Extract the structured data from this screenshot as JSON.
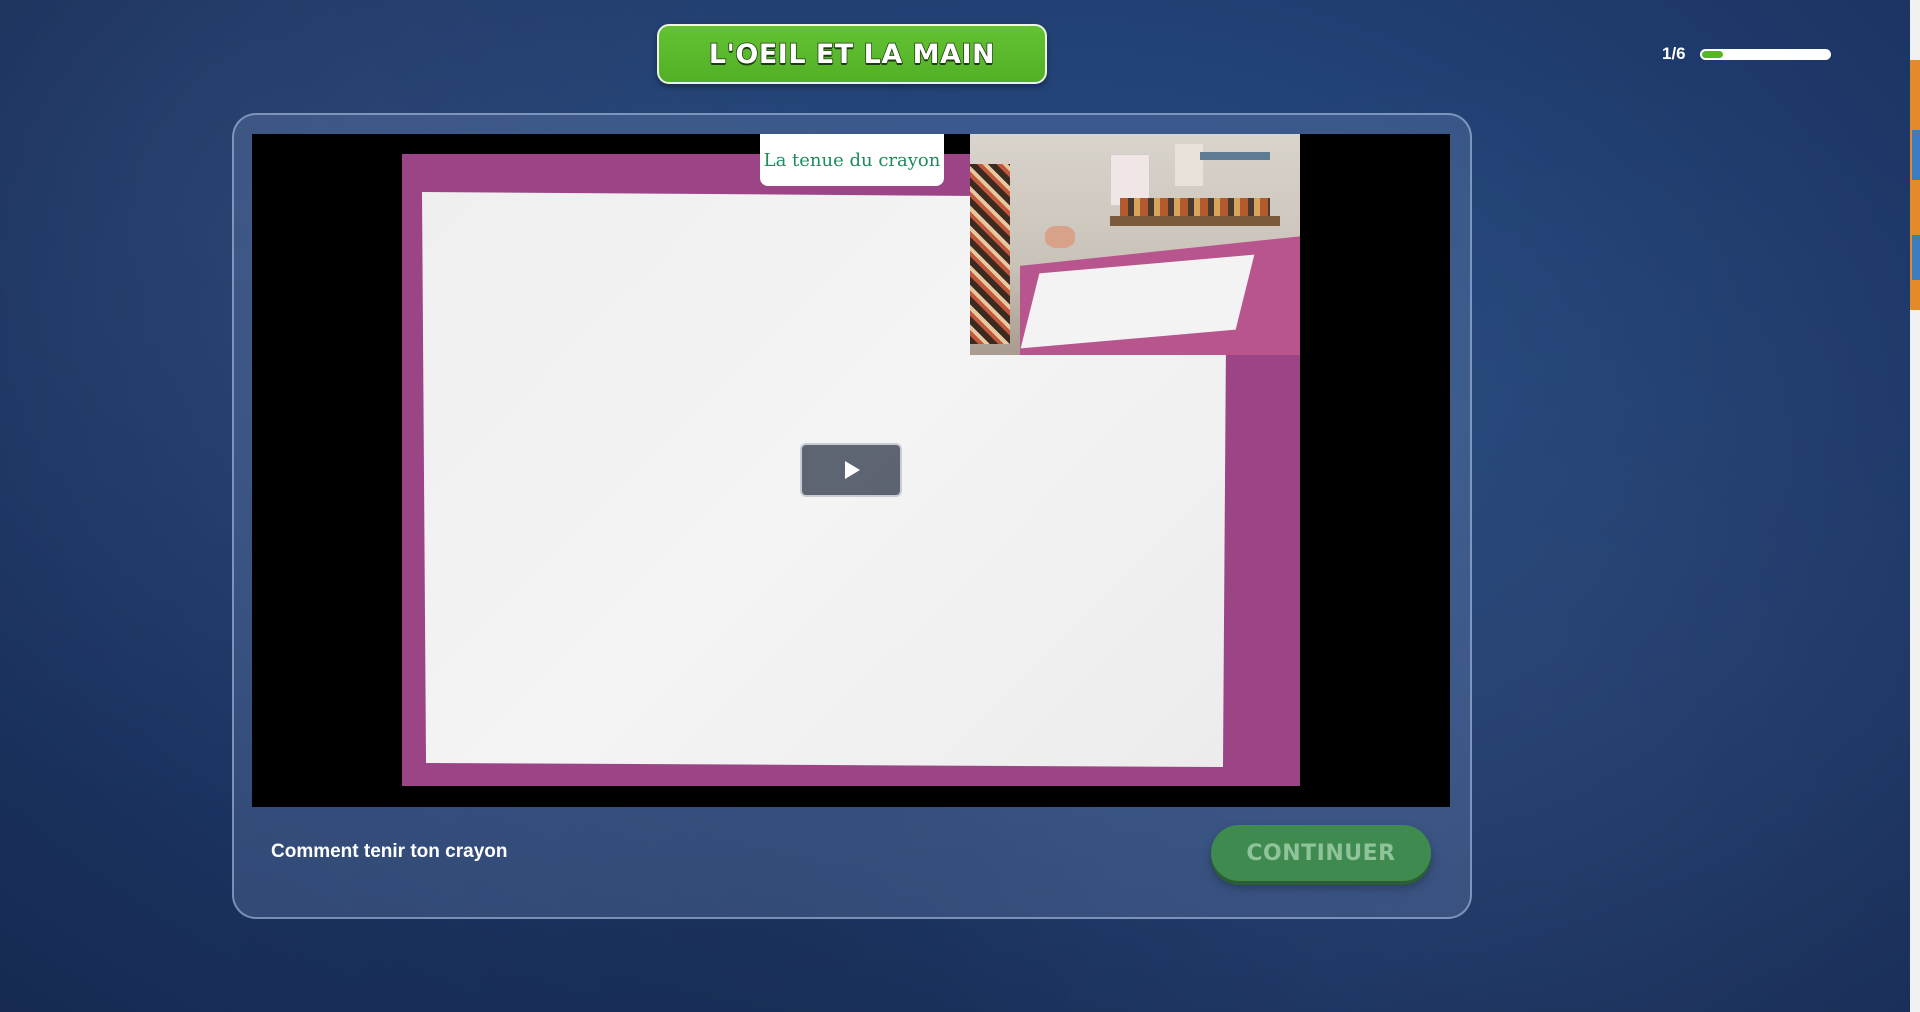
{
  "header": {
    "title": "L'OEIL ET LA MAIN"
  },
  "progress": {
    "label": "1/6",
    "value": 0.1667,
    "fill_color": "#56b52a"
  },
  "video": {
    "chapter_label": "La tenue du crayon",
    "play_icon": "play-icon"
  },
  "lesson": {
    "caption": "Comment tenir ton crayon"
  },
  "actions": {
    "continue_label": "CONTINUER"
  },
  "colors": {
    "accent_green": "#56b52a",
    "continue_button": "#3f8a4e",
    "background": "#213f72"
  }
}
